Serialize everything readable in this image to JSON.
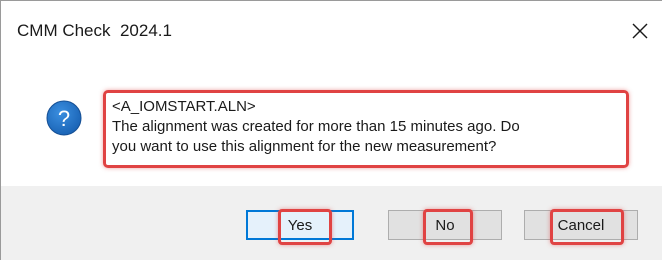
{
  "window": {
    "title": "CMM Check  2024.1"
  },
  "message": {
    "line1": "<A_IOMSTART.ALN>",
    "line2": "The alignment was created for more than 15 minutes ago. Do",
    "line3": "you want to use this alignment for the new measurement?"
  },
  "buttons": {
    "yes": "Yes",
    "no": "No",
    "cancel": "Cancel"
  },
  "icons": {
    "dialog": "question-icon",
    "close": "close-icon"
  },
  "colors": {
    "accent": "#0078d7",
    "highlight": "#e04343",
    "footer_bg": "#f0f0f0",
    "button_bg": "#e1e1e1"
  }
}
